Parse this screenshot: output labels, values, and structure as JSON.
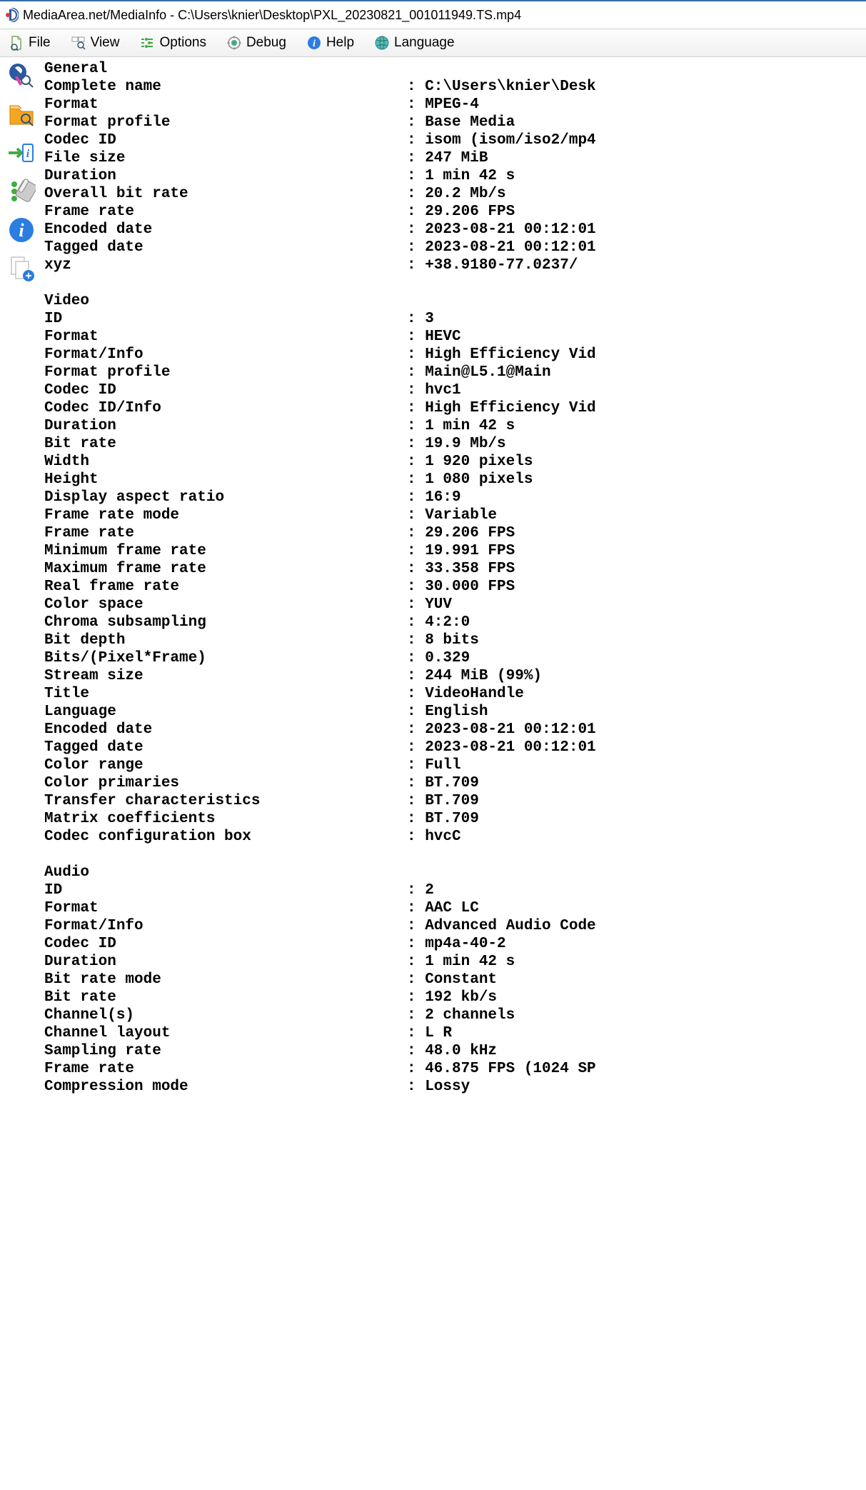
{
  "window": {
    "title": "MediaArea.net/MediaInfo - C:\\Users\\knier\\Desktop\\PXL_20230821_001011949.TS.mp4"
  },
  "menu": {
    "file": "File",
    "view": "View",
    "options": "Options",
    "debug": "Debug",
    "help": "Help",
    "language": "Language"
  },
  "sidebar_icons": [
    "media-search-icon",
    "folder-search-icon",
    "import-info-icon",
    "tools-icon",
    "info-icon",
    "documents-icon"
  ],
  "sections": [
    {
      "header": "General",
      "rows": [
        {
          "k": "Complete name",
          "v": "C:\\Users\\knier\\Desk"
        },
        {
          "k": "Format",
          "v": "MPEG-4"
        },
        {
          "k": "Format profile",
          "v": "Base Media"
        },
        {
          "k": "Codec ID",
          "v": "isom (isom/iso2/mp4"
        },
        {
          "k": "File size",
          "v": "247 MiB"
        },
        {
          "k": "Duration",
          "v": "1 min 42 s"
        },
        {
          "k": "Overall bit rate",
          "v": "20.2 Mb/s"
        },
        {
          "k": "Frame rate",
          "v": "29.206 FPS"
        },
        {
          "k": "Encoded date",
          "v": "2023-08-21 00:12:01"
        },
        {
          "k": "Tagged date",
          "v": "2023-08-21 00:12:01"
        },
        {
          "k": "xyz",
          "v": "+38.9180-77.0237/"
        }
      ]
    },
    {
      "header": "Video",
      "rows": [
        {
          "k": "ID",
          "v": "3"
        },
        {
          "k": "Format",
          "v": "HEVC"
        },
        {
          "k": "Format/Info",
          "v": "High Efficiency Vid"
        },
        {
          "k": "Format profile",
          "v": "Main@L5.1@Main"
        },
        {
          "k": "Codec ID",
          "v": "hvc1"
        },
        {
          "k": "Codec ID/Info",
          "v": "High Efficiency Vid"
        },
        {
          "k": "Duration",
          "v": "1 min 42 s"
        },
        {
          "k": "Bit rate",
          "v": "19.9 Mb/s"
        },
        {
          "k": "Width",
          "v": "1 920 pixels"
        },
        {
          "k": "Height",
          "v": "1 080 pixels"
        },
        {
          "k": "Display aspect ratio",
          "v": "16:9"
        },
        {
          "k": "Frame rate mode",
          "v": "Variable"
        },
        {
          "k": "Frame rate",
          "v": "29.206 FPS"
        },
        {
          "k": "Minimum frame rate",
          "v": "19.991 FPS"
        },
        {
          "k": "Maximum frame rate",
          "v": "33.358 FPS"
        },
        {
          "k": "Real frame rate",
          "v": "30.000 FPS"
        },
        {
          "k": "Color space",
          "v": "YUV"
        },
        {
          "k": "Chroma subsampling",
          "v": "4:2:0"
        },
        {
          "k": "Bit depth",
          "v": "8 bits"
        },
        {
          "k": "Bits/(Pixel*Frame)",
          "v": "0.329"
        },
        {
          "k": "Stream size",
          "v": "244 MiB (99%)"
        },
        {
          "k": "Title",
          "v": "VideoHandle"
        },
        {
          "k": "Language",
          "v": "English"
        },
        {
          "k": "Encoded date",
          "v": "2023-08-21 00:12:01"
        },
        {
          "k": "Tagged date",
          "v": "2023-08-21 00:12:01"
        },
        {
          "k": "Color range",
          "v": "Full"
        },
        {
          "k": "Color primaries",
          "v": "BT.709"
        },
        {
          "k": "Transfer characteristics",
          "v": "BT.709"
        },
        {
          "k": "Matrix coefficients",
          "v": "BT.709"
        },
        {
          "k": "Codec configuration box",
          "v": "hvcC"
        }
      ]
    },
    {
      "header": "Audio",
      "rows": [
        {
          "k": "ID",
          "v": "2"
        },
        {
          "k": "Format",
          "v": "AAC LC"
        },
        {
          "k": "Format/Info",
          "v": "Advanced Audio Code"
        },
        {
          "k": "Codec ID",
          "v": "mp4a-40-2"
        },
        {
          "k": "Duration",
          "v": "1 min 42 s"
        },
        {
          "k": "Bit rate mode",
          "v": "Constant"
        },
        {
          "k": "Bit rate",
          "v": "192 kb/s"
        },
        {
          "k": "Channel(s)",
          "v": "2 channels"
        },
        {
          "k": "Channel layout",
          "v": "L R"
        },
        {
          "k": "Sampling rate",
          "v": "48.0 kHz"
        },
        {
          "k": "Frame rate",
          "v": "46.875 FPS (1024 SP"
        },
        {
          "k": "Compression mode",
          "v": "Lossy"
        }
      ]
    }
  ]
}
